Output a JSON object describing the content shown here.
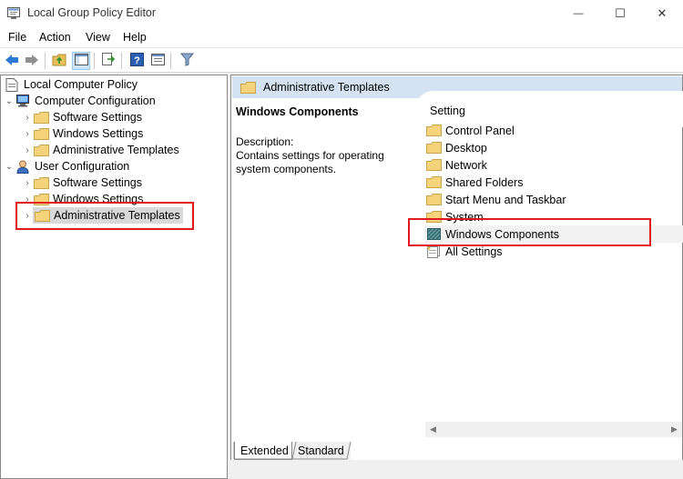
{
  "window": {
    "title": "Local Group Policy Editor",
    "minimize_glyph": "—",
    "maximize_glyph": "☐",
    "close_glyph": "✕"
  },
  "menu": [
    "File",
    "Action",
    "View",
    "Help"
  ],
  "toolbar": {
    "buttons": [
      "back-arrow-icon",
      "forward-arrow-icon",
      "up-folder-icon",
      "show-hide-tree-icon",
      "export-list-icon",
      "help-icon",
      "properties-icon",
      "filter-icon"
    ]
  },
  "tree": {
    "root": "Local Computer Policy",
    "computer_config": {
      "label": "Computer Configuration",
      "children": [
        "Software Settings",
        "Windows Settings",
        "Administrative Templates"
      ]
    },
    "user_config": {
      "label": "User Configuration",
      "children": [
        "Software Settings",
        "Windows Settings",
        "Administrative Templates"
      ]
    }
  },
  "right_pane": {
    "header": "Administrative Templates",
    "selected_title": "Windows Components",
    "description_label": "Description:",
    "description_text": "Contains settings for operating system components.",
    "column_header": "Setting",
    "items": [
      "Control Panel",
      "Desktop",
      "Network",
      "Shared Folders",
      "Start Menu and Taskbar",
      "System",
      "Windows Components",
      "All Settings"
    ]
  },
  "tabs": [
    "Extended",
    "Standard"
  ],
  "colors": {
    "highlight_box": "#e0191e",
    "header_bg": "#d4e2f2",
    "folder": "#f5d37a"
  }
}
